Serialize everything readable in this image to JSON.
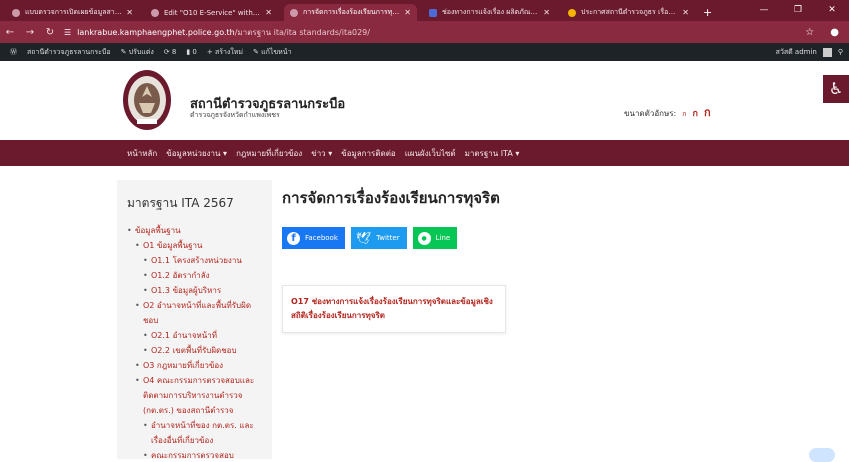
{
  "browser": {
    "tabs": [
      {
        "title": "แบบตรวจการเปิดเผยข้อมูลสาธารณะ",
        "active": false
      },
      {
        "title": "Edit \"O10 E-Service\" with Eleme",
        "active": false
      },
      {
        "title": "การจัดการเรื่องร้องเรียนการทุจริต – ...",
        "active": true
      },
      {
        "title": "ช่องทางการแจ้งเรื่อง ผลิตภัณฑ์ และช่อง",
        "active": false
      },
      {
        "title": "ประกาศสถานีตำรวจภูธร เรื่อง แนวทาง",
        "active": false
      }
    ],
    "new_tab": "+",
    "url_domain": "lankrabue.kamphaengphet.police.go.th",
    "url_path": "/มาตรฐาน ita/ita standards/ita029/"
  },
  "wp_admin_bar": {
    "site_name": "สถานีตำรวจภูธรลานกระบือ",
    "customize": "ปรับแต่ง",
    "updates": "8",
    "comments": "0",
    "new": "สร้างใหม่",
    "edit": "แก้ไขหน้า",
    "greeting": "สวัสดี admin"
  },
  "site": {
    "title": "สถานีตำรวจภูธรลานกระบือ",
    "subtitle": "ตำรวจภูธรจังหวัดกำแพงเพชร",
    "font_size_label": "ขนาดตัวอักษร:",
    "font_small": "ก",
    "font_medium": "ก",
    "font_large": "ก"
  },
  "nav": [
    "หน้าหลัก",
    "ข้อมูลหน่วยงาน ▾",
    "กฎหมายที่เกี่ยวข้อง",
    "ข่าว ▾",
    "ข้อมูลการติดต่อ",
    "แผนผังเว็บไซต์",
    "มาตรฐาน ITA ▾"
  ],
  "sidebar": {
    "title": "มาตรฐาน ITA 2567",
    "items": [
      {
        "label": "ข้อมูลพื้นฐาน",
        "level": 1
      },
      {
        "label": "O1 ข้อมูลพื้นฐาน",
        "level": 2
      },
      {
        "label": "O1.1 โครงสร้างหน่วยงาน",
        "level": 3
      },
      {
        "label": "O1.2 อัตรากำลัง",
        "level": 3
      },
      {
        "label": "O1.3 ข้อมูลผู้บริหาร",
        "level": 3
      },
      {
        "label": "O2 อำนาจหน้าที่และพื้นที่รับผิดชอบ",
        "level": 2
      },
      {
        "label": "O2.1 อำนาจหน้าที่",
        "level": 3
      },
      {
        "label": "O2.2 เขตพื้นที่รับผิดชอบ",
        "level": 3
      },
      {
        "label": "O3 กฎหมายที่เกี่ยวข้อง",
        "level": 2
      },
      {
        "label": "O4 คณะกรรมการตรวจสอบและติดตามการบริหารงานตำรวจ (กต.ตร.) ของสถานีตำรวจ",
        "level": 2
      },
      {
        "label": "อำนาจหน้าที่ของ กต.ตร. และเรื่องอื่นที่เกี่ยวข้อง",
        "level": 3
      },
      {
        "label": "คณะกรรมการตรวจสอบ",
        "level": 3
      }
    ]
  },
  "main": {
    "page_title": "การจัดการเรื่องร้องเรียนการทุจริต",
    "share": {
      "facebook": "Facebook",
      "twitter": "Twitter",
      "line": "Line"
    },
    "card_text": "O17 ช่องทางการแจ้งเรื่องร้องเรียนการทุจริตและข้อมูลเชิงสถิติเรื่องร้องเรียนการทุจริต"
  },
  "colors": {
    "brand": "#6b1a2d",
    "link": "#b3261e"
  }
}
